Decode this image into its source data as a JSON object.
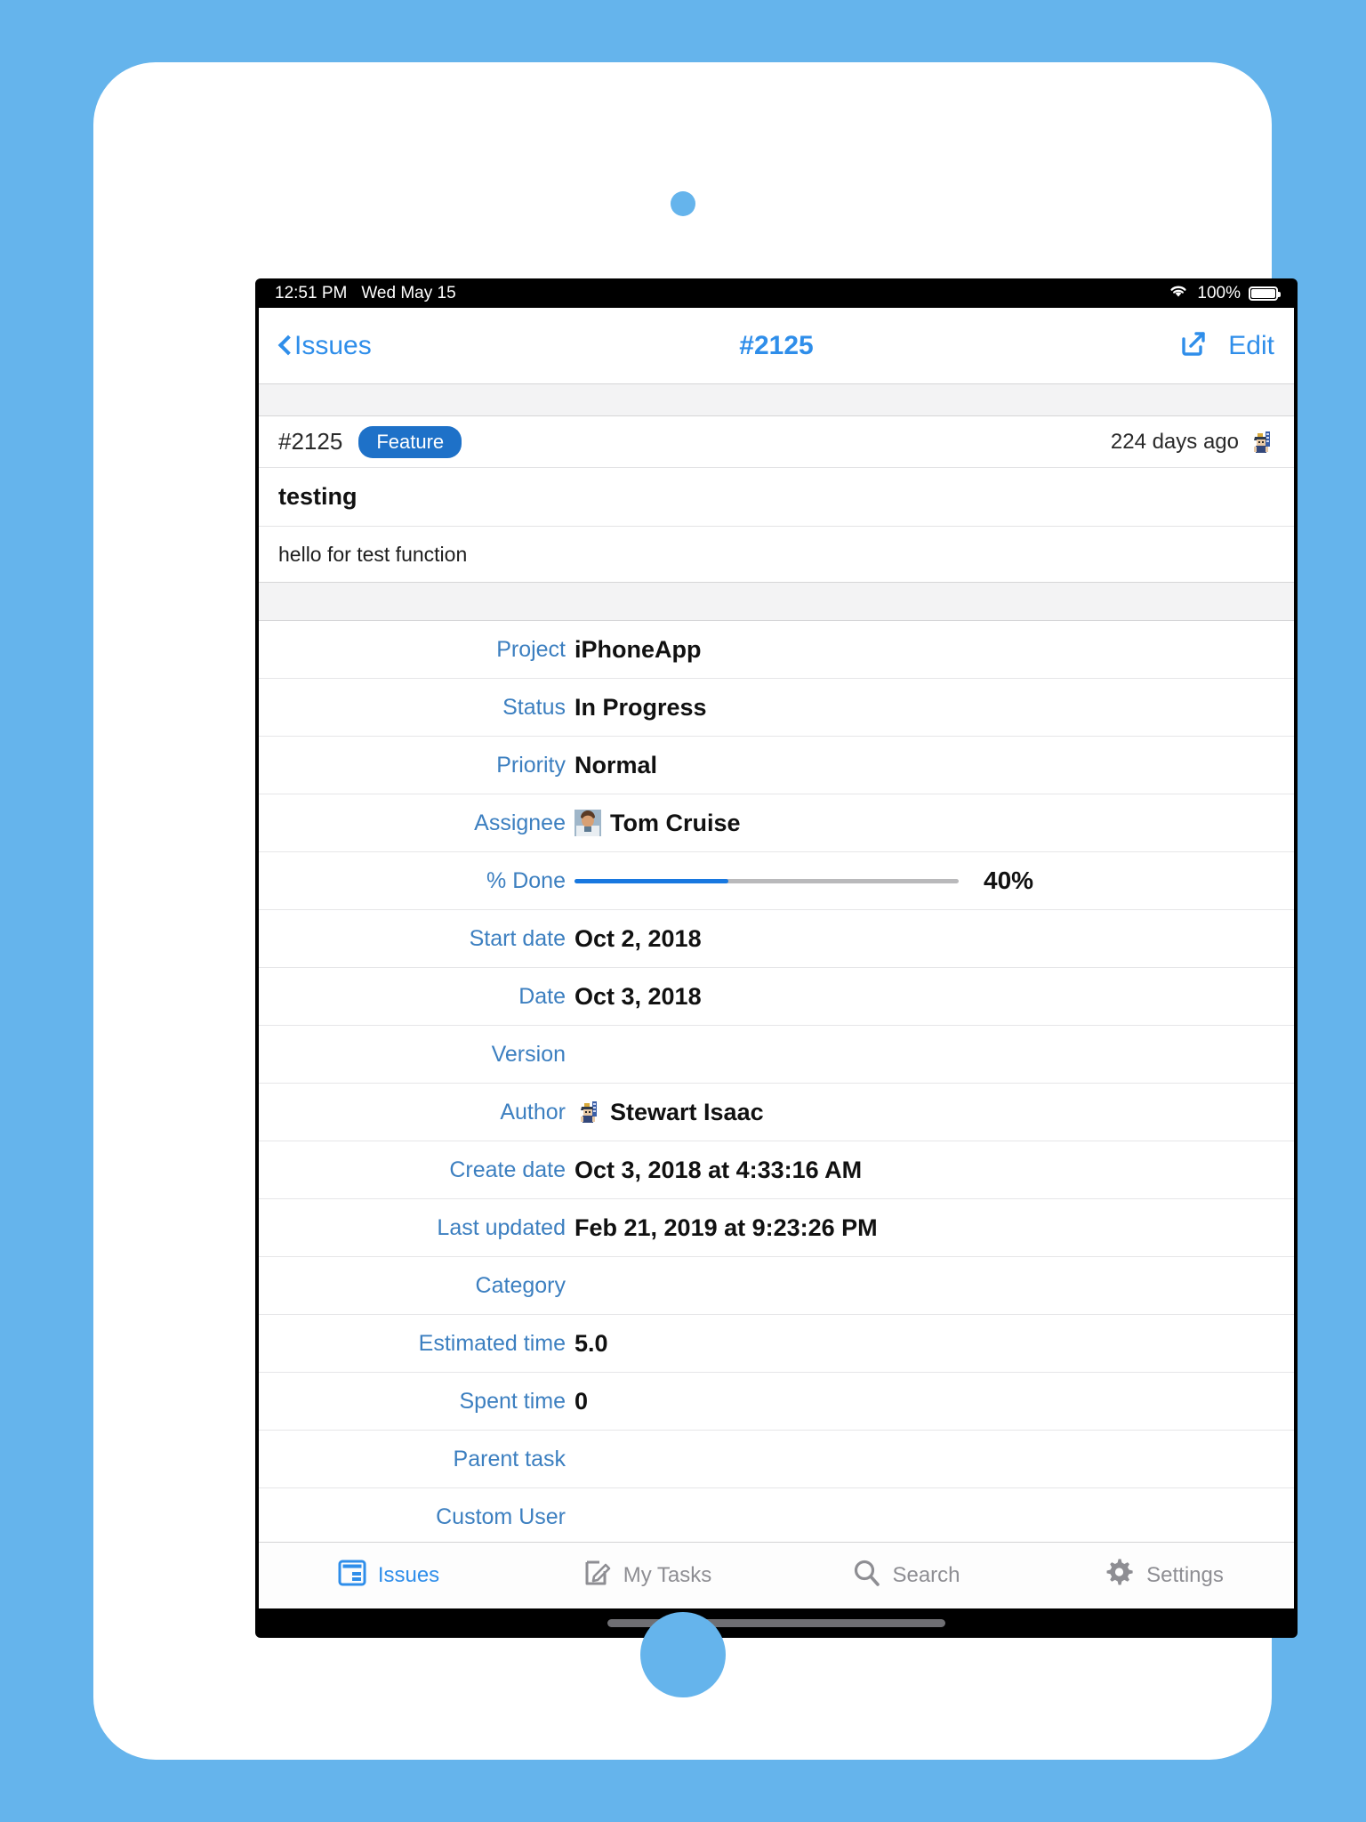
{
  "theme": {
    "background": "#65b4ec",
    "accent": "#2f8eea",
    "label_blue": "#3c7fc0",
    "badge_blue": "#1e71c8",
    "progress_blue": "#1878e0",
    "tab_inactive": "#8e8e93"
  },
  "status_bar": {
    "time": "12:51 PM",
    "date": "Wed May 15",
    "wifi_icon": "wifi-icon",
    "battery_percent": "100%",
    "battery_icon": "battery-icon"
  },
  "nav_bar": {
    "back_icon": "chevron-left-icon",
    "back_label": "Issues",
    "title": "#2125",
    "share_icon": "share-icon",
    "edit_label": "Edit"
  },
  "issue": {
    "number": "#2125",
    "tracker": "Feature",
    "age": "224 days ago",
    "author_avatar_icon": "samurai-avatar-icon",
    "subject": "testing",
    "description": "hello for test function"
  },
  "fields": [
    {
      "label": "Project",
      "value": "iPhoneApp",
      "type": "text"
    },
    {
      "label": "Status",
      "value": "In Progress",
      "type": "text"
    },
    {
      "label": "Priority",
      "value": "Normal",
      "type": "text"
    },
    {
      "label": "Assignee",
      "value": "Tom Cruise",
      "type": "avatar-text",
      "avatar_icon": "person-avatar-icon"
    },
    {
      "label": "% Done",
      "value": "40%",
      "type": "progress",
      "percent": 40
    },
    {
      "label": "Start date",
      "value": "Oct 2, 2018",
      "type": "text"
    },
    {
      "label": "Date",
      "value": "Oct 3, 2018",
      "type": "text"
    },
    {
      "label": "Version",
      "value": "",
      "type": "text"
    },
    {
      "label": "Author",
      "value": "Stewart Isaac",
      "type": "avatar-text",
      "avatar_icon": "samurai-avatar-icon"
    },
    {
      "label": "Create date",
      "value": "Oct 3, 2018 at 4:33:16 AM",
      "type": "text"
    },
    {
      "label": "Last updated",
      "value": "Feb 21, 2019 at 9:23:26 PM",
      "type": "text"
    },
    {
      "label": "Category",
      "value": "",
      "type": "text"
    },
    {
      "label": "Estimated time",
      "value": "5.0",
      "type": "text"
    },
    {
      "label": "Spent time",
      "value": "0",
      "type": "text"
    },
    {
      "label": "Parent task",
      "value": "",
      "type": "text"
    },
    {
      "label": "Custom User",
      "value": "",
      "type": "text"
    }
  ],
  "tab_bar": {
    "items": [
      {
        "label": "Issues",
        "icon": "issues-card-icon",
        "active": true
      },
      {
        "label": "My Tasks",
        "icon": "pencil-note-icon",
        "active": false
      },
      {
        "label": "Search",
        "icon": "search-icon",
        "active": false
      },
      {
        "label": "Settings",
        "icon": "gear-icon",
        "active": false
      }
    ]
  }
}
